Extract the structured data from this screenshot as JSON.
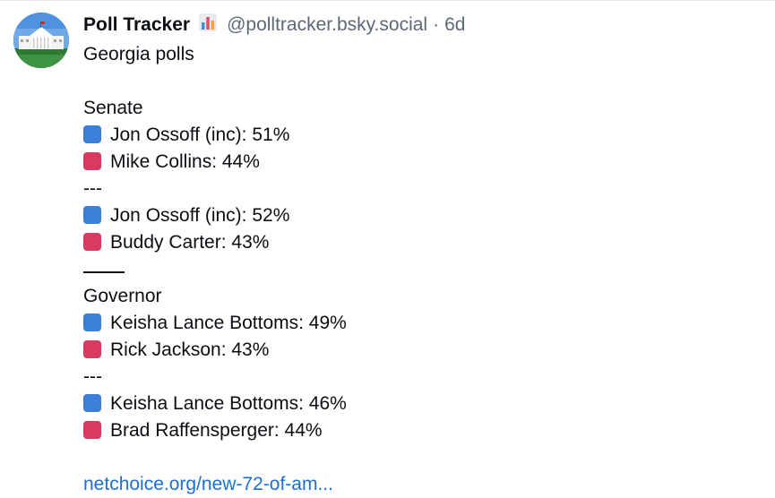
{
  "post": {
    "author_name": "Poll Tracker",
    "badge_icon": "bar-chart-emoji",
    "handle": "@polltracker.bsky.social",
    "separator": "·",
    "time": "6d",
    "intro": "Georgia polls",
    "senate_heading": "Senate",
    "senate_a": [
      {
        "color": "blue",
        "text": "Jon Ossoff (inc): 51%"
      },
      {
        "color": "red",
        "text": "Mike Collins: 44%"
      }
    ],
    "senate_divider": "---",
    "senate_b": [
      {
        "color": "blue",
        "text": "Jon Ossoff (inc): 52%"
      },
      {
        "color": "red",
        "text": "Buddy Carter: 43%"
      }
    ],
    "governor_heading": "Governor",
    "governor_a": [
      {
        "color": "blue",
        "text": "Keisha Lance Bottoms: 49%"
      },
      {
        "color": "red",
        "text": "Rick Jackson: 43%"
      }
    ],
    "governor_divider": "---",
    "governor_b": [
      {
        "color": "blue",
        "text": "Keisha Lance Bottoms: 46%"
      },
      {
        "color": "red",
        "text": "Brad Raffensperger: 44%"
      }
    ],
    "link_text": "netchoice.org/new-72-of-am..."
  },
  "colors": {
    "blue_square": "#3c7fd9",
    "red_square": "#db3a60",
    "link": "#1c6fd6",
    "muted": "#5c6878"
  }
}
